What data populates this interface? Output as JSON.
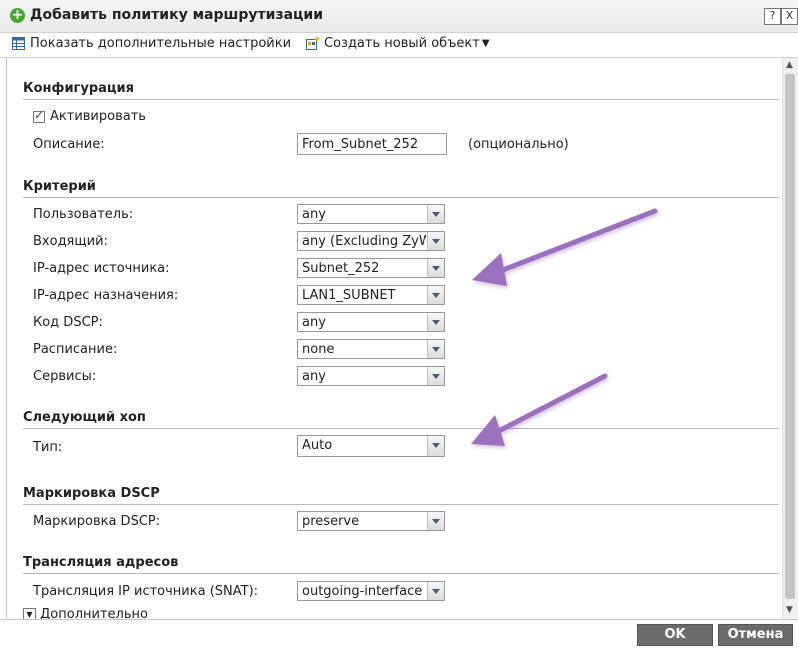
{
  "window": {
    "title": "Добавить политику маршрутизации",
    "help_button": "?",
    "close_button": "X"
  },
  "toolbar": {
    "show_advanced": "Показать дополнительные настройки",
    "create_object": "Создать новый объект"
  },
  "config": {
    "section_title": "Конфигурация",
    "activate_label": "Активировать",
    "activate_checked": true,
    "description_label": "Описание:",
    "description_value": "From_Subnet_252",
    "description_note": "(опционально)"
  },
  "criteria": {
    "section_title": "Критерий",
    "rows": [
      {
        "label": "Пользователь:",
        "value": "any"
      },
      {
        "label": "Входящий:",
        "value": "any (Excluding ZyW"
      },
      {
        "label": "IP-адрес источника:",
        "value": "Subnet_252"
      },
      {
        "label": "IP-адрес назначения:",
        "value": "LAN1_SUBNET"
      },
      {
        "label": "Код DSCP:",
        "value": "any"
      },
      {
        "label": "Расписание:",
        "value": "none"
      },
      {
        "label": "Сервисы:",
        "value": "any"
      }
    ]
  },
  "next_hop": {
    "section_title": "Следующий хоп",
    "type_label": "Тип:",
    "type_value": "Auto"
  },
  "dscp_marking": {
    "section_title": "Маркировка DSCP",
    "label": "Маркировка DSCP:",
    "value": "preserve"
  },
  "nat": {
    "section_title": "Трансляция адресов",
    "snat_label": "Трансляция IP источника (SNAT):",
    "snat_value": "outgoing-interface",
    "advanced_toggle": "Дополнительно"
  },
  "footer": {
    "ok": "OK",
    "cancel": "Отмена"
  },
  "colors": {
    "arrow": "#9b6fbf",
    "add_icon": "#46a72f",
    "button": "#6c6c6c"
  }
}
